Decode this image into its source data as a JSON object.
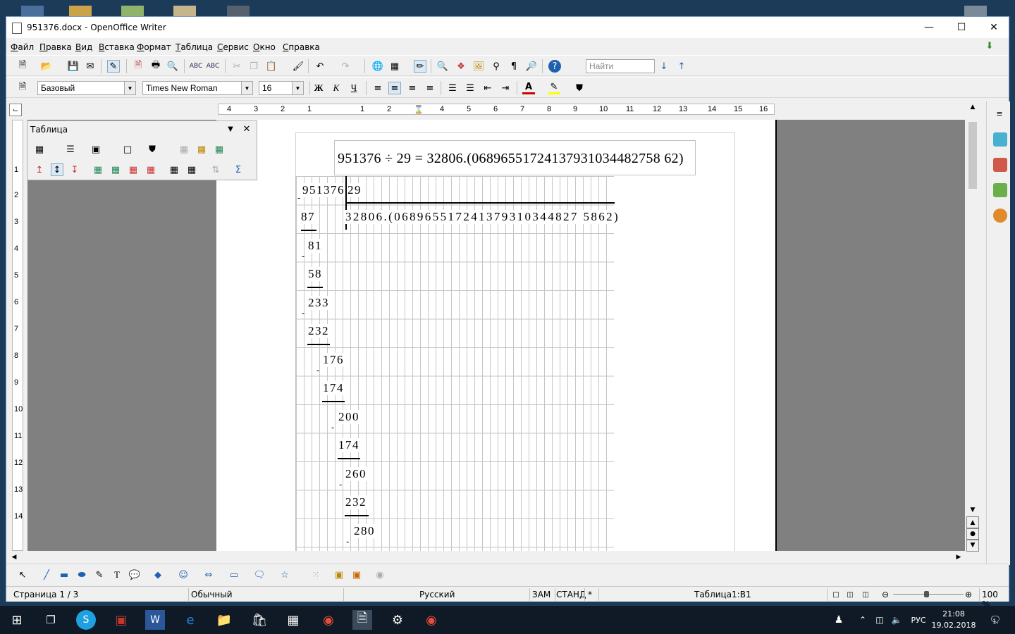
{
  "window": {
    "title": "951376.docx - OpenOffice Writer"
  },
  "menu": [
    "Файл",
    "Правка",
    "Вид",
    "Вставка",
    "Формат",
    "Таблица",
    "Сервис",
    "Окно",
    "Справка"
  ],
  "format_toolbar": {
    "style": "Базовый",
    "font": "Times New Roman",
    "size": "16"
  },
  "find": {
    "placeholder": "Найти"
  },
  "hruler": [
    "4",
    "3",
    "2",
    "1",
    "1",
    "2",
    "3",
    "4",
    "5",
    "6",
    "7",
    "8",
    "9",
    "10",
    "11",
    "12",
    "13",
    "14",
    "15",
    "16"
  ],
  "vruler": [
    "1",
    "1",
    "2",
    "3",
    "4",
    "5",
    "6",
    "7",
    "8",
    "9",
    "10",
    "11",
    "12",
    "13",
    "14"
  ],
  "table_panel": {
    "title": "Таблица"
  },
  "document": {
    "formula": "951376 ÷ 29 = 32806.(06896551724137931034482758 62)",
    "dividend": "951376",
    "divisor": "29",
    "quotient": "32806.(068965517241379310344827 5862)",
    "steps": [
      "87",
      "81",
      "58",
      "233",
      "232",
      "176",
      "174",
      "200",
      "174",
      "260",
      "232",
      "280"
    ]
  },
  "status": {
    "page": "Страница  1 / 3",
    "style": "Обычный",
    "lang": "Русский",
    "mode1": "ЗАМ",
    "mode2": "СТАНД",
    "mod": "*",
    "cell": "Таблица1:B1",
    "zoom": "100 %"
  },
  "taskbar": {
    "lang": "РУС",
    "time": "21:08",
    "date": "19.02.2018",
    "notif": "1"
  }
}
